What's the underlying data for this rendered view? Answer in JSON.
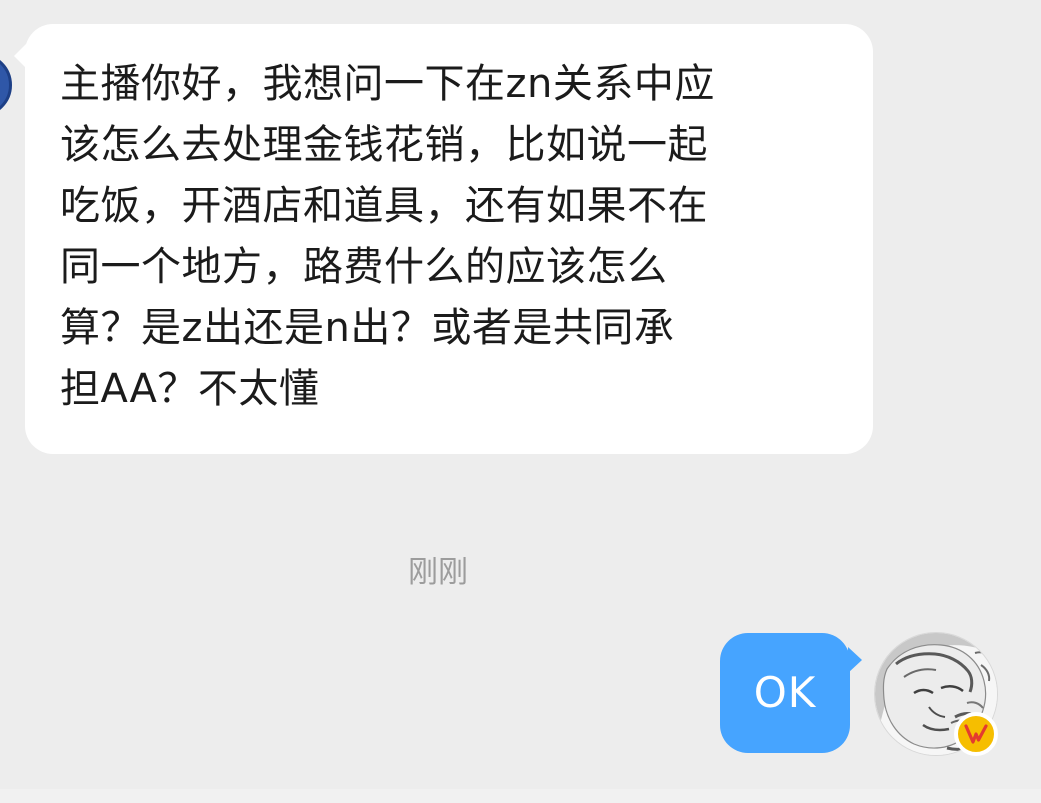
{
  "chat": {
    "incoming_message": "主播你好，我想问一下在zn关系中应\n该怎么去处理金钱花销，比如说一起\n吃饭，开酒店和道具，还有如果不在\n同一个地方，路费什么的应该怎么\n算？是z出还是n出？或者是共同承\n担AA？不太懂",
    "timestamp": "刚刚",
    "outgoing_message": "OK"
  },
  "colors": {
    "background": "#ededed",
    "incoming_bubble": "#ffffff",
    "outgoing_bubble": "#46a4ff",
    "badge": "#f6be00"
  },
  "icons": {
    "left_avatar": "profile-avatar-icon",
    "right_avatar": "profile-avatar-icon",
    "badge": "verified-badge-icon"
  }
}
